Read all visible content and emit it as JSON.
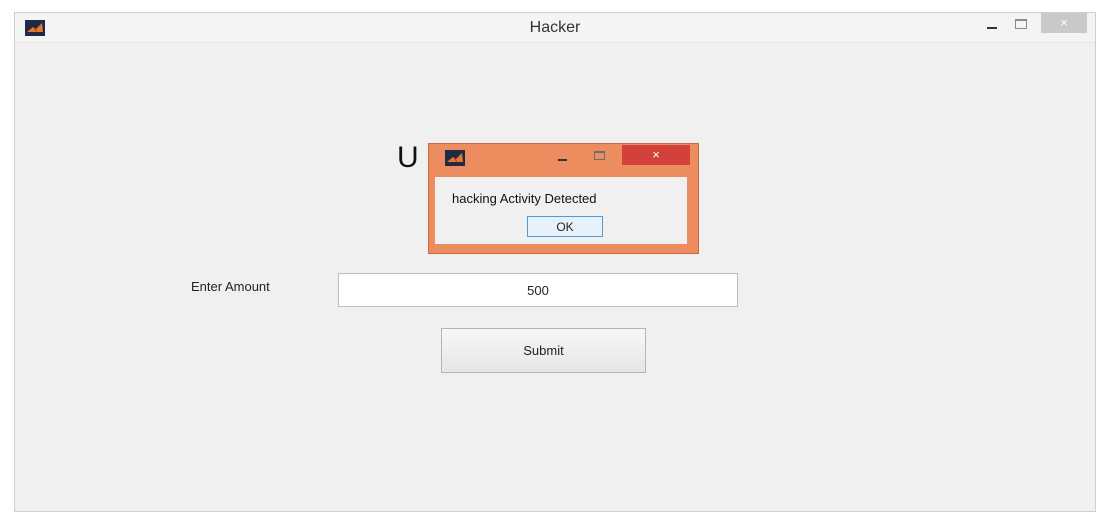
{
  "window": {
    "title": "Hacker",
    "controls": {
      "minimize_icon": "minimize-icon",
      "maximize_icon": "maximize-icon",
      "close_glyph": "×"
    },
    "app_icon": "matlab-icon"
  },
  "main": {
    "partial_heading": "U",
    "amount_label": "Enter Amount",
    "amount_value": "500",
    "submit_label": "Submit"
  },
  "dialog": {
    "app_icon": "matlab-icon",
    "message": "hacking Activity Detected",
    "ok_label": "OK",
    "close_glyph": "×"
  },
  "colors": {
    "dialog_frame": "#ec8c5f",
    "dialog_close": "#d4403a",
    "window_background": "#f0f0f0",
    "ok_border": "#4f9bd9"
  }
}
